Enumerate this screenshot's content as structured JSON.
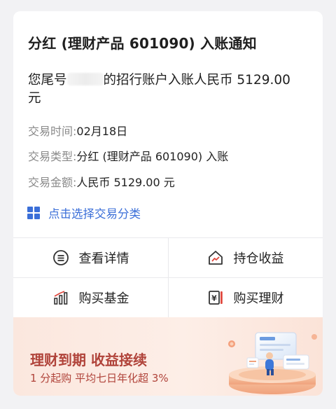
{
  "notification": {
    "title": "分红 (理财产品 601090) 入账通知",
    "body_prefix": "您尾号",
    "body_suffix": "的招行账户入账人民币 5129.00",
    "body_line2": "元",
    "details": [
      {
        "label": "交易时间:",
        "value": "02月18日"
      },
      {
        "label": "交易类型:",
        "value": "分红 (理财产品 601090) 入账"
      },
      {
        "label": "交易金额:",
        "value": "人民币 5129.00 元"
      }
    ],
    "classify_label": "点击选择交易分类"
  },
  "actions": [
    {
      "label": "查看详情",
      "icon": "list-circle-icon"
    },
    {
      "label": "持仓收益",
      "icon": "house-chart-icon"
    },
    {
      "label": "购买基金",
      "icon": "bar-chart-icon"
    },
    {
      "label": "购买理财",
      "icon": "yen-document-icon"
    }
  ],
  "banner": {
    "title": "理财到期 收益接续",
    "subtitle": "1 分起购 平均七日年化超 3%"
  },
  "colors": {
    "accent_blue": "#3b6fd8",
    "banner_red": "#b0433a",
    "icon_red": "#e0473d"
  }
}
